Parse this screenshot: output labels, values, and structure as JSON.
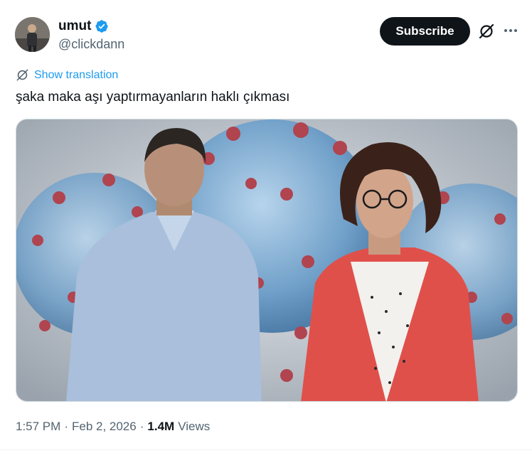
{
  "author": {
    "display_name": "umut",
    "handle": "@clickdann",
    "verified": true,
    "verified_color": "#1d9bf0"
  },
  "actions": {
    "subscribe_label": "Subscribe",
    "grok_icon": "grok-icon",
    "more_icon": "more-icon"
  },
  "translation": {
    "label": "Show translation",
    "icon": "translate-icon"
  },
  "tweet": {
    "text": "şaka maka aşı yaptırmayanların haklı çıkması"
  },
  "meta": {
    "time": "1:57 PM",
    "sep1": "·",
    "date": "Feb 2, 2026",
    "sep2": "·",
    "views_count": "1.4M",
    "views_label": "Views"
  },
  "colors": {
    "text": "#0f1419",
    "secondary": "#536471",
    "accent": "#1d9bf0"
  }
}
